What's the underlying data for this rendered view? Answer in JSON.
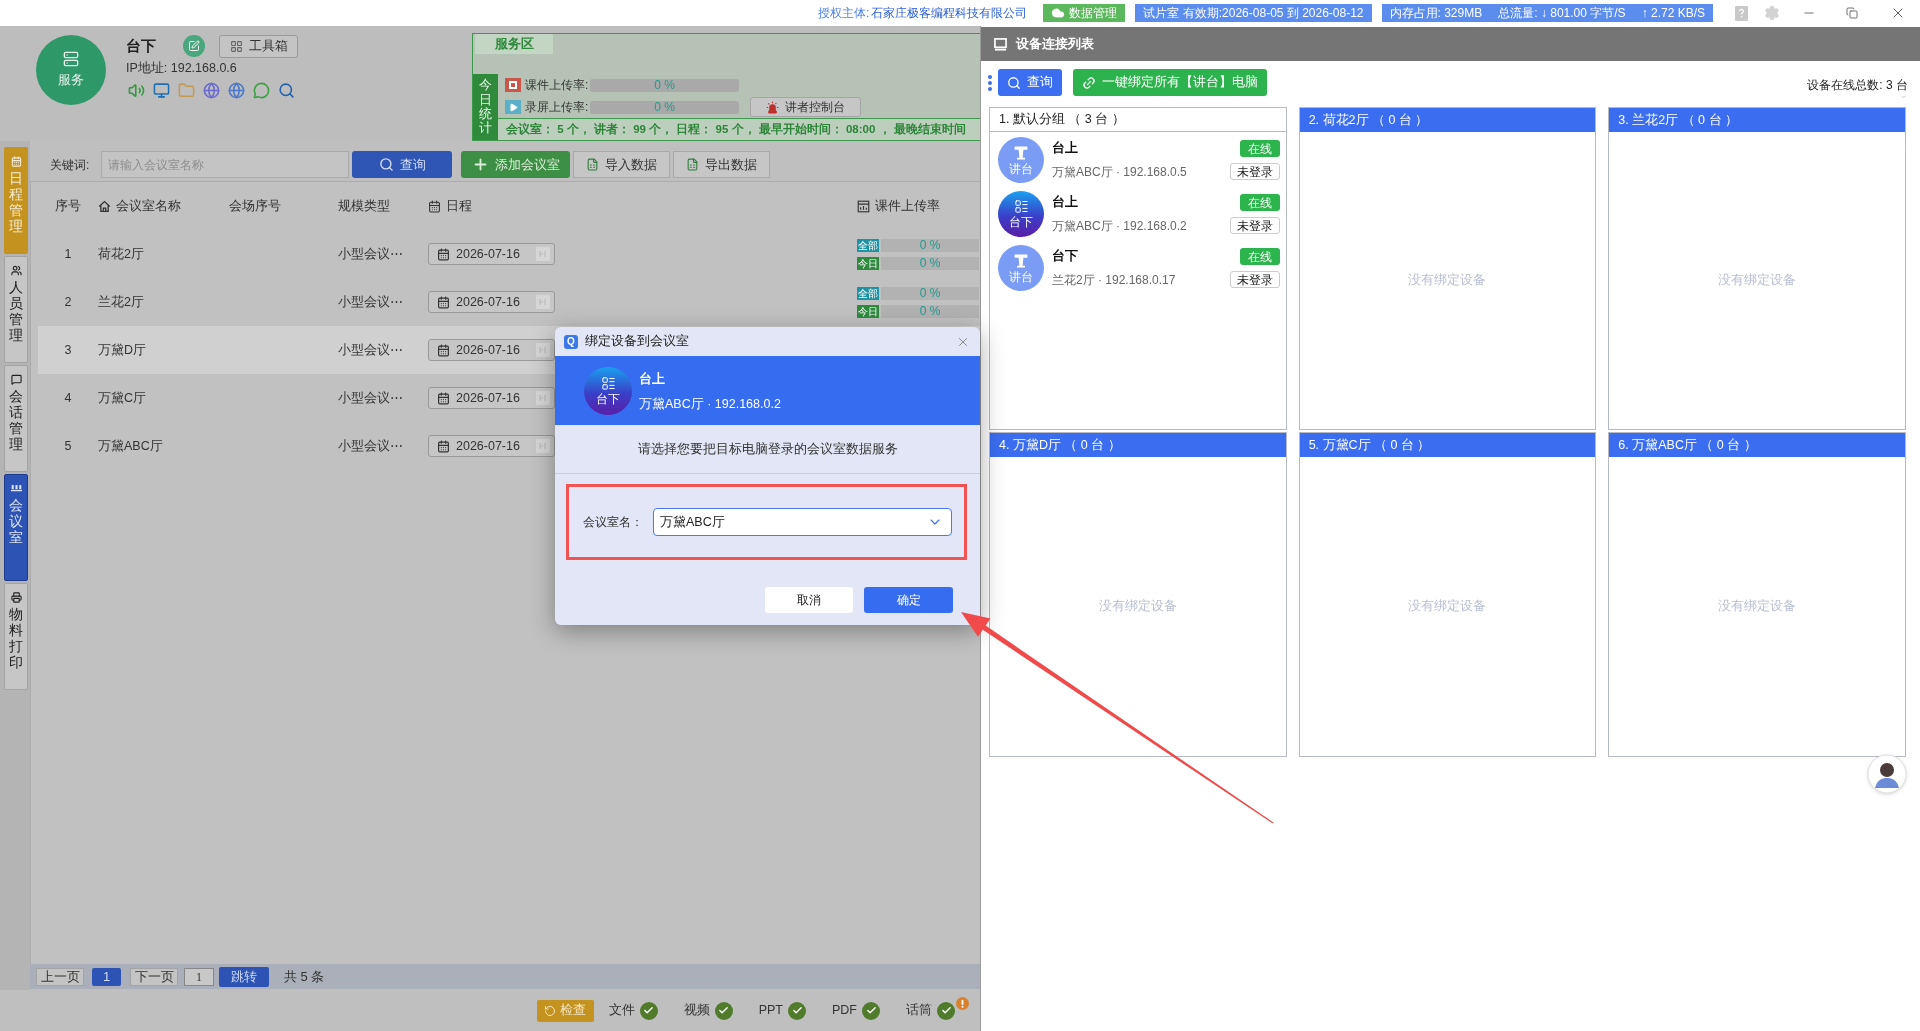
{
  "top_bar": {
    "license_label": "授权主体:",
    "license_holder": "石家庄极客编程科技有限公司",
    "badges": [
      {
        "kind": "cloud",
        "texts": [
          "数据管理"
        ]
      },
      {
        "kind": "info",
        "texts": [
          "试片室 有效期:2026-08-05 到 2026-08-12"
        ]
      },
      {
        "kind": "info",
        "texts": [
          "内存占用: 329MB",
          "总流量: ↓ 801.00 字节/S",
          "↑ 2.72 KB/S"
        ]
      }
    ]
  },
  "header": {
    "avatar_label": "服务",
    "name": "台下",
    "ip": "IP地址: 192.168.0.6",
    "toolbox_button": "工具箱"
  },
  "service_area": {
    "title": "服务区",
    "side_label": "今日统计",
    "rates": [
      {
        "kind": "ppt",
        "label": "课件上传率:",
        "level": 0,
        "reading": "0 %"
      },
      {
        "kind": "video",
        "label": "录屏上传率:",
        "level": 0,
        "reading": "0 %"
      }
    ],
    "console_button": "讲者控制台",
    "summary": "会议室： 5 个， 讲者： 99 个， 日程： 95 个， 最早开始时间： 08:00 ， 最晚结束时间"
  },
  "sidebar": {
    "tabs": [
      {
        "label": "日程管理",
        "selected": false,
        "highlighted": true
      },
      {
        "label": "人员管理",
        "selected": false,
        "highlighted": false
      },
      {
        "label": "会话管理",
        "selected": false,
        "highlighted": false
      },
      {
        "label": "会议室",
        "selected": true,
        "highlighted": false
      },
      {
        "label": "物料打印",
        "selected": false,
        "highlighted": false
      }
    ]
  },
  "toolbar": {
    "keyword_label": "关键词:",
    "search_placeholder": "请输入会议室名称",
    "buttons": [
      {
        "kind": "search",
        "label": "查询"
      },
      {
        "kind": "add",
        "label": "添加会议室"
      },
      {
        "kind": "import",
        "label": "导入数据"
      },
      {
        "kind": "export",
        "label": "导出数据"
      }
    ]
  },
  "table": {
    "columns": [
      "序号",
      "会议室名称",
      "会场序号",
      "规模类型",
      "日程",
      "课件上传率"
    ],
    "rows": [
      {
        "number": "1",
        "name": "荷花2厅",
        "scale": "小型会议⋯",
        "date": "2026-07-16",
        "selected": false,
        "upload": [
          {
            "tag": "全部",
            "color": "#1e93a6",
            "level": 0,
            "reading": "0 %"
          },
          {
            "tag": "今日",
            "color": "#2e8b3e",
            "level": 0,
            "reading": "0 %"
          }
        ]
      },
      {
        "number": "2",
        "name": "兰花2厅",
        "scale": "小型会议⋯",
        "date": "2026-07-16",
        "selected": false,
        "upload": [
          {
            "tag": "全部",
            "color": "#1e93a6",
            "level": 0,
            "reading": "0 %"
          },
          {
            "tag": "今日",
            "color": "#2e8b3e",
            "level": 0,
            "reading": "0 %"
          }
        ]
      },
      {
        "number": "3",
        "name": "万黛D厅",
        "scale": "小型会议⋯",
        "date": "2026-07-16",
        "selected": true
      },
      {
        "number": "4",
        "name": "万黛C厅",
        "scale": "小型会议⋯",
        "date": "2026-07-16",
        "selected": false
      },
      {
        "number": "5",
        "name": "万黛ABC厅",
        "scale": "小型会议⋯",
        "date": "2026-07-16",
        "selected": false
      }
    ]
  },
  "pagination": {
    "prev_button": "上一页",
    "pages": [
      {
        "label": "1",
        "selected": true
      }
    ],
    "next_button": "下一页",
    "page_input": "1",
    "jump_button": "跳转",
    "total": "共 5 条"
  },
  "status_bar": {
    "check_button": "检查",
    "items": [
      {
        "label": "文件",
        "ok": true,
        "alert": false
      },
      {
        "label": "视频",
        "ok": true,
        "alert": false
      },
      {
        "label": "PPT",
        "ok": true,
        "alert": false
      },
      {
        "label": "PDF",
        "ok": true,
        "alert": false
      },
      {
        "label": "话筒",
        "ok": true,
        "alert": true
      }
    ]
  },
  "dialog": {
    "logo": "Q",
    "title": "绑定设备到会议室",
    "device": {
      "kind": "audience",
      "avatar_label": "台下",
      "name": "台上",
      "detail": "万黛ABC厅 · 192.168.0.2"
    },
    "prompt": "请选择您要把目标电脑登录的会议室数据服务",
    "field_label": "会议室名：",
    "field_value": "万黛ABC厅",
    "buttons": [
      {
        "kind": "secondary",
        "label": "取消"
      },
      {
        "kind": "primary",
        "label": "确定"
      }
    ]
  },
  "device_panel": {
    "title": "设备连接列表",
    "buttons": [
      {
        "kind": "search",
        "label": "查询"
      },
      {
        "kind": "bind",
        "label": "一键绑定所有【讲台】电脑"
      }
    ],
    "online_total": "设备在线总数: 3 台",
    "groups": [
      {
        "kind": "default",
        "title": "1. 默认分组 （ 3 台 ）",
        "devices": [
          {
            "kind": "lectern",
            "avatar_label": "讲台",
            "name": "台上",
            "detail": "万黛ABC厅 · 192.168.0.5",
            "online": true,
            "status": "在线",
            "login": "未登录"
          },
          {
            "kind": "audience",
            "avatar_label": "台下",
            "name": "台上",
            "detail": "万黛ABC厅 · 192.168.0.2",
            "online": true,
            "status": "在线",
            "login": "未登录"
          },
          {
            "kind": "lectern",
            "avatar_label": "讲台",
            "name": "台下",
            "detail": "兰花2厅 · 192.168.0.17",
            "online": true,
            "status": "在线",
            "login": "未登录"
          }
        ]
      },
      {
        "kind": "room",
        "title": "2. 荷花2厅 （ 0 台 ）",
        "empty_text": "没有绑定设备"
      },
      {
        "kind": "room",
        "title": "3. 兰花2厅 （ 0 台 ）",
        "empty_text": "没有绑定设备"
      },
      {
        "kind": "room",
        "title": "4. 万黛D厅 （ 0 台 ）",
        "empty_text": "没有绑定设备"
      },
      {
        "kind": "room",
        "title": "5. 万黛C厅 （ 0 台 ）",
        "empty_text": "没有绑定设备"
      },
      {
        "kind": "room",
        "title": "6. 万黛ABC厅 （ 0 台 ）",
        "empty_text": "没有绑定设备"
      }
    ]
  }
}
